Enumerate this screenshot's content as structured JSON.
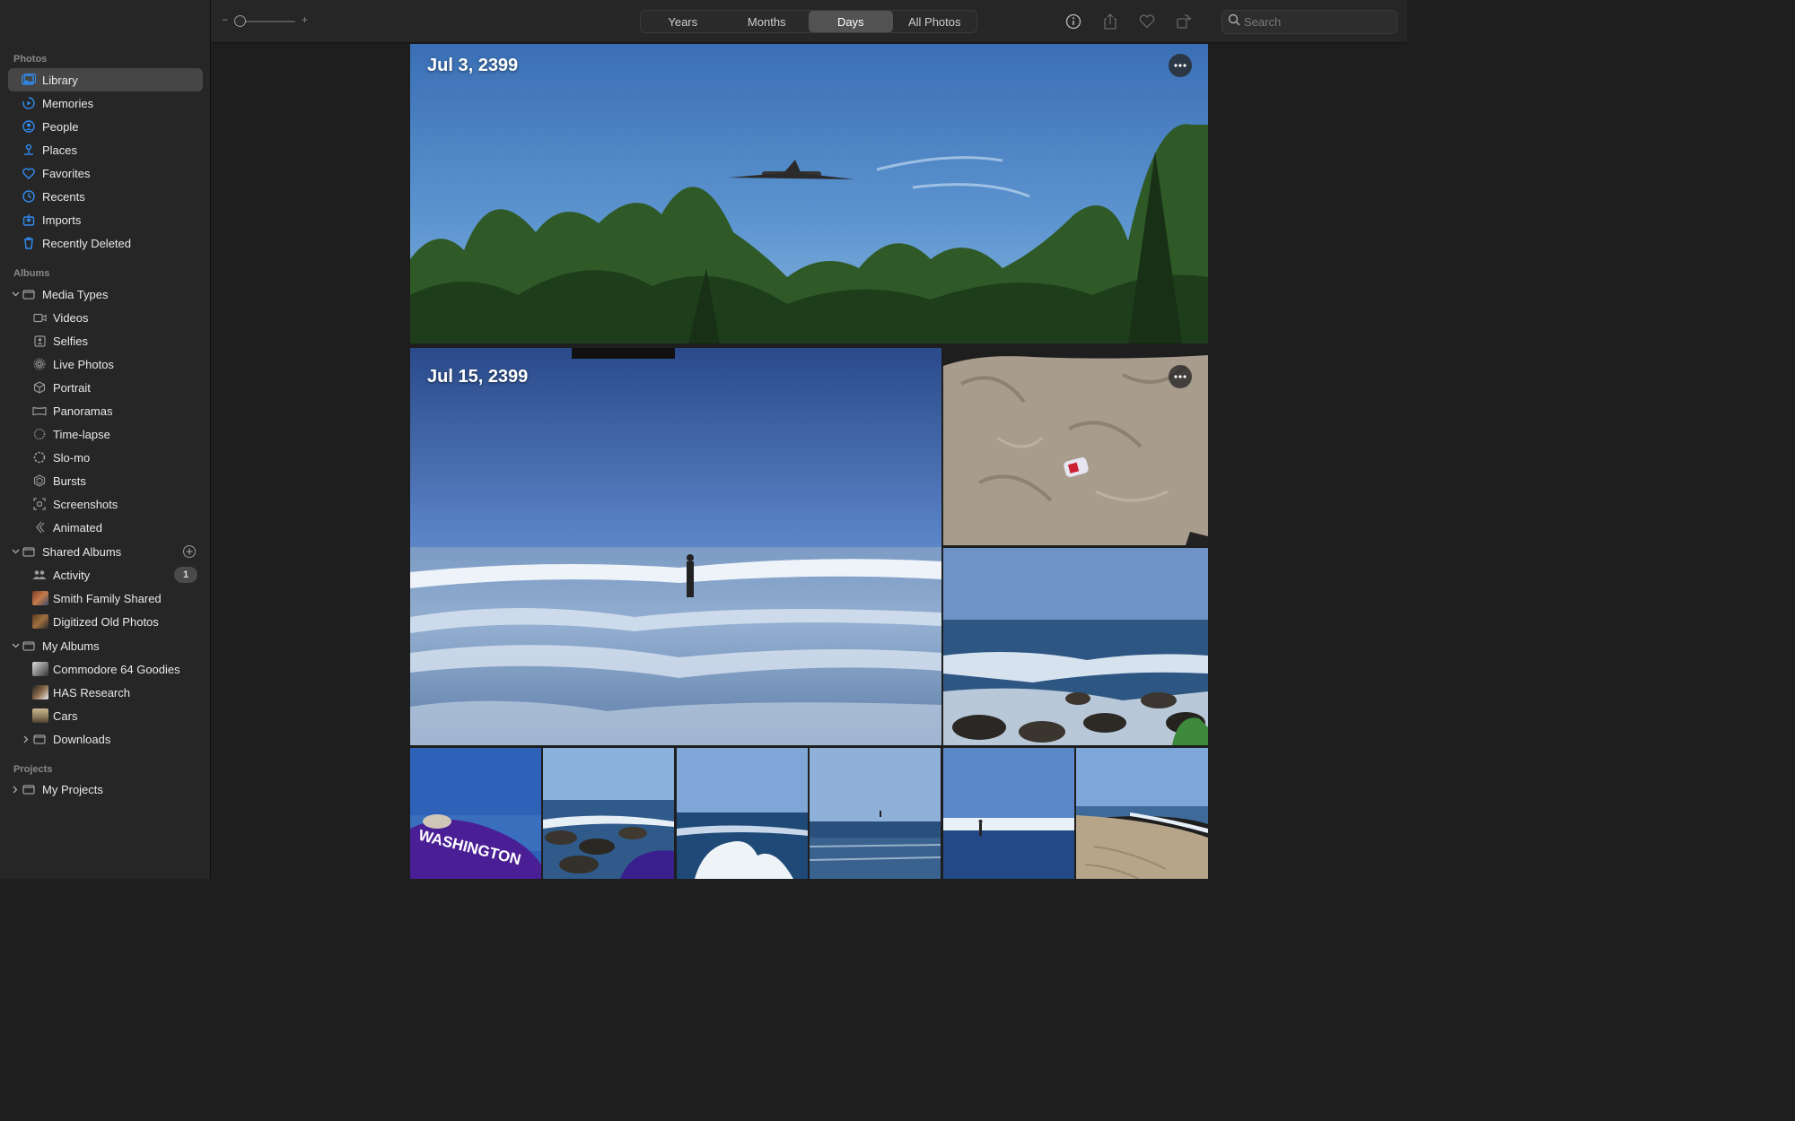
{
  "sidebar": {
    "photos_section": "Photos",
    "items": [
      {
        "label": "Library"
      },
      {
        "label": "Memories"
      },
      {
        "label": "People"
      },
      {
        "label": "Places"
      },
      {
        "label": "Favorites"
      },
      {
        "label": "Recents"
      },
      {
        "label": "Imports"
      },
      {
        "label": "Recently Deleted"
      }
    ],
    "albums_section": "Albums",
    "media_types": {
      "label": "Media Types",
      "items": [
        {
          "label": "Videos"
        },
        {
          "label": "Selfies"
        },
        {
          "label": "Live Photos"
        },
        {
          "label": "Portrait"
        },
        {
          "label": "Panoramas"
        },
        {
          "label": "Time-lapse"
        },
        {
          "label": "Slo-mo"
        },
        {
          "label": "Bursts"
        },
        {
          "label": "Screenshots"
        },
        {
          "label": "Animated"
        }
      ]
    },
    "shared_albums": {
      "label": "Shared Albums",
      "items": [
        {
          "label": "Activity",
          "badge": "1"
        },
        {
          "label": "Smith Family Shared"
        },
        {
          "label": "Digitized Old Photos"
        }
      ]
    },
    "my_albums": {
      "label": "My Albums",
      "items": [
        {
          "label": "Commodore 64 Goodies"
        },
        {
          "label": "HAS Research"
        },
        {
          "label": "Cars"
        },
        {
          "label": "Downloads"
        }
      ]
    },
    "projects_section": "Projects",
    "projects": {
      "label": "My Projects"
    }
  },
  "toolbar": {
    "zoom_minus": "−",
    "zoom_plus": "+",
    "tabs": [
      {
        "label": "Years"
      },
      {
        "label": "Months"
      },
      {
        "label": "Days"
      },
      {
        "label": "All Photos"
      }
    ],
    "active_tab": "Days",
    "search_placeholder": "Search"
  },
  "days": [
    {
      "date": "Jul 3, 2399"
    },
    {
      "date": "Jul 15, 2399"
    }
  ],
  "colors": {
    "accent": "#2f8cf0",
    "sidebar_bg": "#262626",
    "content_bg": "#1e1e1e",
    "selected": "#464646"
  }
}
